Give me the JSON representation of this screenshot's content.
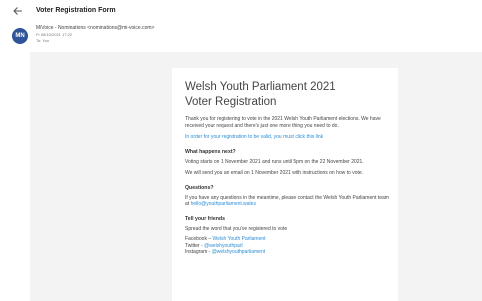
{
  "window": {
    "title": "Voter Registration Form"
  },
  "message": {
    "avatar_initials": "MN",
    "sender": "MiVoice - Nominations <nominations@mi-voice.com>",
    "date": "Fr 08/10/2021 17:22",
    "to": "To: You"
  },
  "email": {
    "heading_line1": "Welsh Youth Parliament 2021",
    "heading_line2": "Voter Registration",
    "intro": "Thank you for registering to vote in the 2021 Welsh Youth Parliament elections. We have received your request and there's just one more thing you need to do.",
    "confirm_link": "In order for your registration to be valid, you must click this link",
    "next_title": "What happens next?",
    "next_p1": "Voting starts on 1 November 2021 and runs until 5pm on the 22 November 2021.",
    "next_p2": "We will send you an email on 1 November 2021 with instructions on how to vote.",
    "questions_title": "Questions?",
    "questions_text": "If you have any questions in the meantime, please contact the Welsh Youth Parliament team at",
    "questions_email": "hello@youthparliament.wales",
    "friends_title": "Tell your friends",
    "friends_text": "Spread the word that you've registered to vote",
    "facebook_label": "Facebook – ",
    "facebook_link": "Welsh Youth Parliament",
    "twitter_label": "Twitter - ",
    "twitter_link": "@welshyouthparl",
    "instagram_label": "Instagram - ",
    "instagram_link": "@welshyouthparliament"
  },
  "colors": {
    "avatar_bg": "#2f5497",
    "link": "#2d8ed6",
    "panel_bg": "#f3f3f3"
  }
}
